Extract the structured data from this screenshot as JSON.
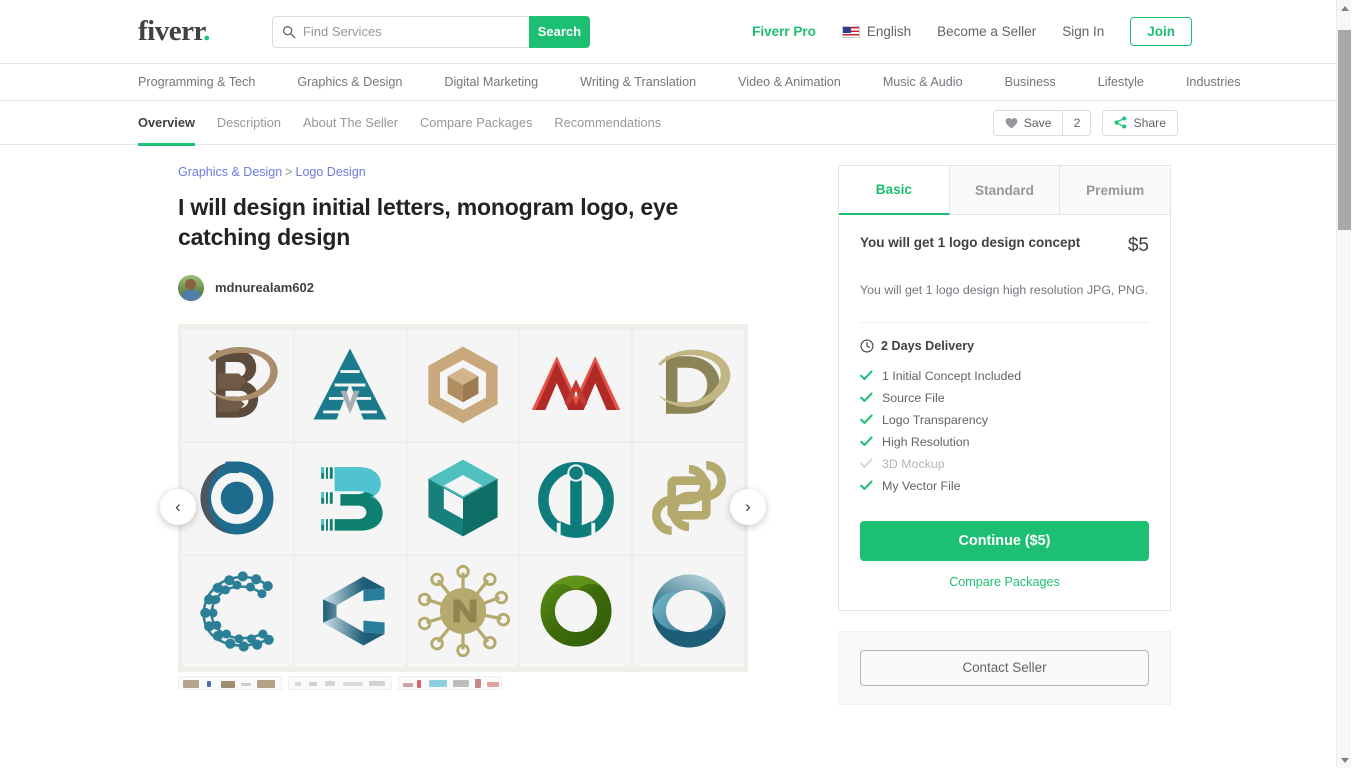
{
  "header": {
    "logo_text": "fiverr",
    "logo_dot": ".",
    "search": {
      "placeholder": "Find Services",
      "value": "",
      "button_label": "Search",
      "icon": "search-icon"
    },
    "pro_label": "Fiverr Pro",
    "language": "English",
    "language_flag_icon": "us-flag-icon",
    "become_seller": "Become a Seller",
    "sign_in": "Sign In",
    "join": "Join",
    "accent_green": "#1dbf73"
  },
  "categories": [
    "Programming & Tech",
    "Graphics & Design",
    "Digital Marketing",
    "Writing & Translation",
    "Video & Animation",
    "Music & Audio",
    "Business",
    "Lifestyle",
    "Industries"
  ],
  "gig_tabs": [
    {
      "label": "Overview",
      "active": true
    },
    {
      "label": "Description",
      "active": false
    },
    {
      "label": "About The Seller",
      "active": false
    },
    {
      "label": "Compare Packages",
      "active": false
    },
    {
      "label": "Recommendations",
      "active": false
    }
  ],
  "tab_actions": {
    "save_label": "Save",
    "save_icon": "heart-icon",
    "save_count": "2",
    "share_label": "Share",
    "share_icon": "share-icon"
  },
  "breadcrumb": {
    "parent": "Graphics & Design",
    "separator": ">",
    "child": "Logo Design"
  },
  "gig": {
    "title": "I will design initial letters, monogram logo, eye catching design",
    "seller_name": "mdnurealam602",
    "avatar_icon": "seller-avatar"
  },
  "gallery": {
    "prev_icon": "chevron-left-icon",
    "next_icon": "chevron-right-icon",
    "items": [
      {
        "name": "logo-b-swoosh",
        "letter": "B",
        "colors": [
          "#8d7358",
          "#5d4c3b"
        ]
      },
      {
        "name": "logo-a-triangle",
        "letter": "A",
        "colors": [
          "#1b7b8c",
          "#a9adb0"
        ]
      },
      {
        "name": "logo-hex-cube-tan",
        "letter": "",
        "colors": [
          "#c8a87c",
          "#b08f63"
        ]
      },
      {
        "name": "logo-m-peaks-red",
        "letter": "M",
        "colors": [
          "#e8504a",
          "#b02b25"
        ]
      },
      {
        "name": "logo-d-ring-gold",
        "letter": "D",
        "colors": [
          "#c2b684",
          "#8a8456"
        ]
      },
      {
        "name": "logo-p-circle-blue",
        "letter": "P",
        "colors": [
          "#1f6b8e",
          "#4d5560"
        ]
      },
      {
        "name": "logo-b-stripes",
        "letter": "B",
        "colors": [
          "#4fc3d0",
          "#0e8070"
        ]
      },
      {
        "name": "logo-cube-teal",
        "letter": "",
        "colors": [
          "#4fbfc0",
          "#0d6e66"
        ]
      },
      {
        "name": "logo-o-i-teal",
        "letter": "O",
        "colors": [
          "#0e7c7b",
          "#0e7c7b"
        ]
      },
      {
        "name": "logo-knot-gold",
        "letter": "",
        "colors": [
          "#b5aa6d",
          "#b5aa6d"
        ]
      },
      {
        "name": "logo-c-molecule",
        "letter": "C",
        "colors": [
          "#2b7f97",
          "#2b7f97"
        ]
      },
      {
        "name": "logo-c-hexagon-3d",
        "letter": "C",
        "colors": [
          "#cfe3ea",
          "#1d5d77"
        ]
      },
      {
        "name": "logo-n-virus-gold",
        "letter": "N",
        "colors": [
          "#b5aa6d",
          "#8f8550"
        ]
      },
      {
        "name": "logo-o-ring-green",
        "letter": "O",
        "colors": [
          "#4b7d10",
          "#2f5a08"
        ]
      },
      {
        "name": "logo-o-twist-blue",
        "letter": "O",
        "colors": [
          "#7fc3d8",
          "#1d5d77"
        ]
      }
    ],
    "thumbnails": [
      "thumb-1",
      "thumb-2",
      "thumb-3"
    ]
  },
  "package": {
    "tabs": [
      {
        "label": "Basic",
        "active": true
      },
      {
        "label": "Standard",
        "active": false
      },
      {
        "label": "Premium",
        "active": false
      }
    ],
    "name": "You will get 1 logo design concept",
    "price": "$5",
    "description": "You will get 1 logo design high resolution JPG, PNG.",
    "delivery": "2 Days Delivery",
    "delivery_icon": "clock-icon",
    "features": [
      {
        "label": "1 Initial Concept Included",
        "included": true
      },
      {
        "label": "Source File",
        "included": true
      },
      {
        "label": "Logo Transparency",
        "included": true
      },
      {
        "label": "High Resolution",
        "included": true
      },
      {
        "label": "3D Mockup",
        "included": false
      },
      {
        "label": "My Vector File",
        "included": true
      }
    ],
    "continue_label": "Continue ($5)",
    "compare_label": "Compare Packages",
    "contact_label": "Contact Seller"
  }
}
